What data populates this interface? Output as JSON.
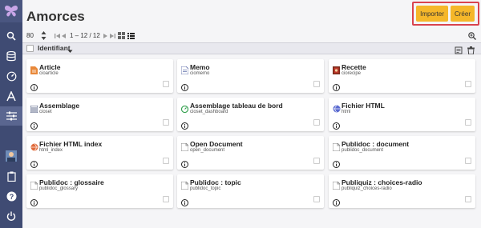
{
  "page": {
    "title": "Amorces"
  },
  "actions": {
    "import_label": "Importer",
    "create_label": "Créer"
  },
  "toolbar": {
    "page_size": "80",
    "pagination": "1 – 12 / 12"
  },
  "table": {
    "sort_column": "Identifiant"
  },
  "cards": [
    {
      "title": "Article",
      "subtitle": "cioarticle",
      "icon": "article-doc-icon",
      "color": "#e8883a"
    },
    {
      "title": "Memo",
      "subtitle": "ciomemo",
      "icon": "memo-icon",
      "color": "#6b78b0"
    },
    {
      "title": "Recette",
      "subtitle": "ciorecipe",
      "icon": "recipe-icon",
      "color": "#c0392b"
    },
    {
      "title": "Assemblage",
      "subtitle": "cioset",
      "icon": "assembly-icon",
      "color": "#3f4b73"
    },
    {
      "title": "Assemblage tableau de bord",
      "subtitle": "cioset_dashboard",
      "icon": "dashboard-icon",
      "color": "#2e9e4a"
    },
    {
      "title": "Fichier HTML",
      "subtitle": "html",
      "icon": "html-globe-icon",
      "color": "#5a6ad0"
    },
    {
      "title": "Fichier HTML index",
      "subtitle": "html_index",
      "icon": "html-index-icon",
      "color": "#e06a3a"
    },
    {
      "title": "Open Document",
      "subtitle": "open_document",
      "icon": "document-icon",
      "color": "#888888"
    },
    {
      "title": "Publidoc : document",
      "subtitle": "publidoc_document",
      "icon": "document-icon",
      "color": "#888888"
    },
    {
      "title": "Publidoc : glossaire",
      "subtitle": "publidoc_glossary",
      "icon": "document-icon",
      "color": "#888888"
    },
    {
      "title": "Publidoc : topic",
      "subtitle": "publidoc_topic",
      "icon": "document-icon",
      "color": "#888888"
    },
    {
      "title": "Publiquiz : choices-radio",
      "subtitle": "publiquiz_choices-radio",
      "icon": "document-icon",
      "color": "#888888"
    }
  ],
  "colors": {
    "sidebar": "#3f4b73",
    "accent_button": "#f5b72a",
    "highlight_border": "#d9434e"
  }
}
